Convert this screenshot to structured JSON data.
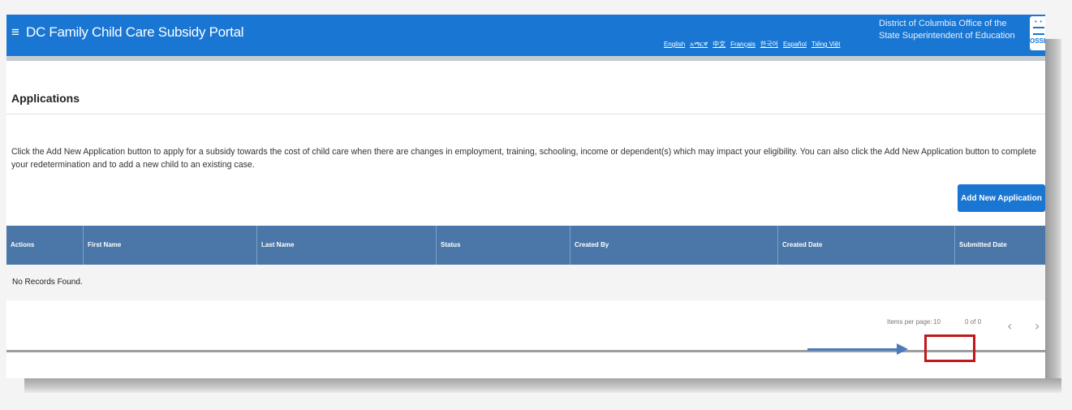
{
  "header": {
    "menu_icon": "hamburger-menu-icon",
    "title": "DC Family Child Care Subsidy Portal",
    "languages": [
      "English",
      "አማርኛ",
      "中文",
      "Français",
      "한국어",
      "Español",
      "Tiếng Việt"
    ],
    "org_name": "District of Columbia Office of the State Superintendent of Education",
    "logo_label": "OSSE"
  },
  "page": {
    "heading": "Applications",
    "intro": "Click the Add New Application button to apply for a subsidy towards the cost of child care when there are changes in employment, training, schooling, income or dependent(s) which may impact your eligibility. You can also click the Add New Application button to complete your redetermination and to add a new child to an existing case.",
    "add_button_label": "Add New Application"
  },
  "table": {
    "columns": [
      "Actions",
      "First Name",
      "Last Name",
      "Status",
      "Created By",
      "Created Date",
      "Submitted Date"
    ],
    "empty_message": "No Records Found."
  },
  "paginator": {
    "items_per_page_label": "Items per page:",
    "items_per_page_value": "10",
    "range_label": "0 of 0",
    "prev_icon": "chevron-left-icon",
    "next_icon": "chevron-right-icon"
  },
  "annotation": {
    "arrow_color": "#4a7bbd",
    "box_color": "#c0181b"
  },
  "colors": {
    "primary": "#1976d2",
    "table_header": "#4a76a8"
  }
}
